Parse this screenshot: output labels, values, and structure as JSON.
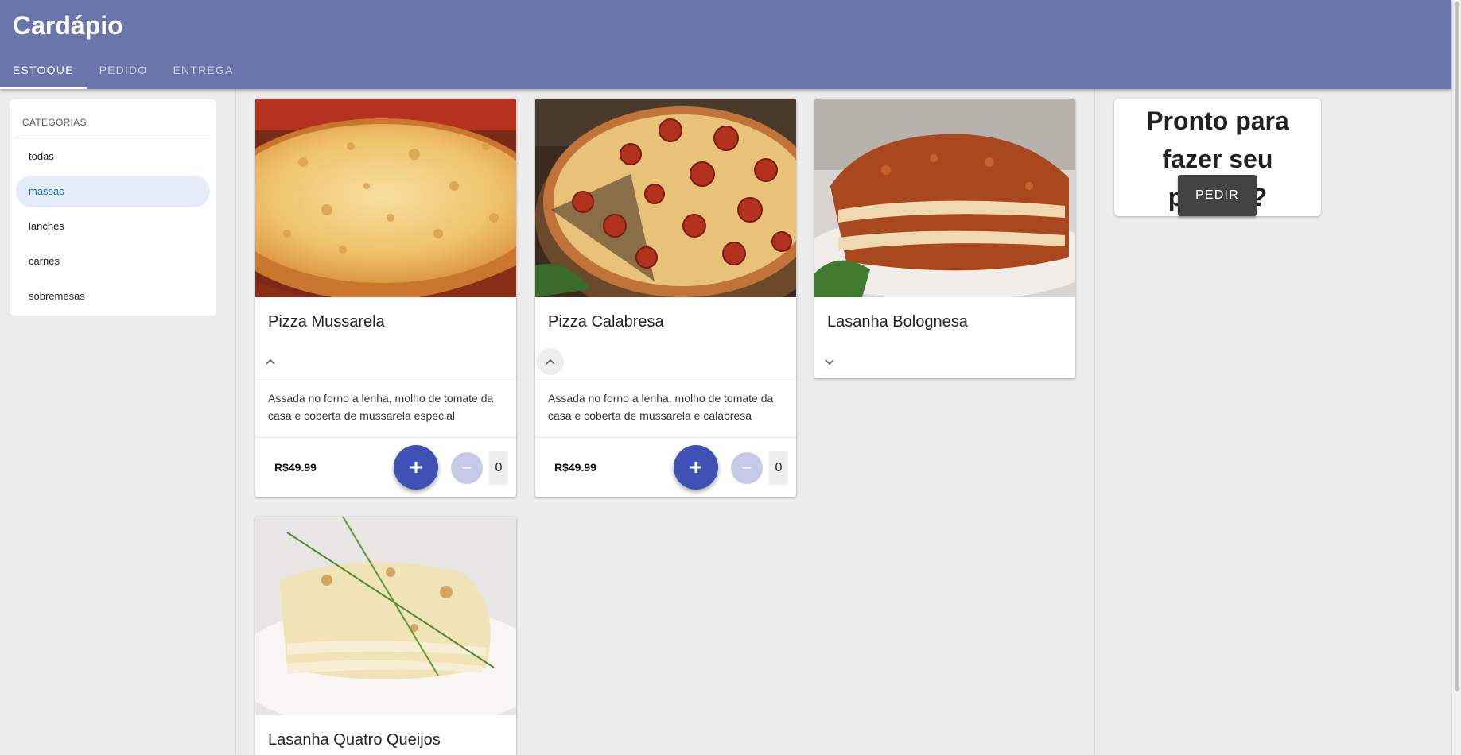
{
  "app": {
    "title": "Cardápio"
  },
  "tabs": [
    {
      "label": "ESTOQUE",
      "active": true
    },
    {
      "label": "PEDIDO",
      "active": false
    },
    {
      "label": "ENTREGA",
      "active": false
    }
  ],
  "sidebar": {
    "header": "CATEGORIAS",
    "items": [
      {
        "label": "todas",
        "selected": false
      },
      {
        "label": "massas",
        "selected": true
      },
      {
        "label": "lanches",
        "selected": false
      },
      {
        "label": "carnes",
        "selected": false
      },
      {
        "label": "sobremesas",
        "selected": false
      }
    ]
  },
  "products": [
    {
      "name": "Pizza Mussarela",
      "description": "Assada no forno a lenha, molho de tomate da casa e coberta de mussarela especial",
      "price": "R$49.99",
      "quantity": "0",
      "add_label": "+",
      "remove_label": "−",
      "expanded": true,
      "expand_icon": "chevron-up-icon"
    },
    {
      "name": "Pizza Calabresa",
      "description": "Assada no forno a lenha, molho de tomate da casa e coberta de mussarela e calabresa",
      "price": "R$49.99",
      "quantity": "0",
      "add_label": "+",
      "remove_label": "−",
      "expanded": true,
      "expand_icon": "chevron-up-icon"
    },
    {
      "name": "Lasanha Bolognesa",
      "expanded": false,
      "expand_icon": "chevron-down-icon"
    },
    {
      "name": "Lasanha Quatro Queijos"
    }
  ],
  "order": {
    "prompt": "Pronto para fazer seu pedido?",
    "button_label": "PEDIR"
  },
  "colors": {
    "appbar": "#6a75ab",
    "primary": "#3f51b5",
    "primary_light": "#c5cae9",
    "selected_bg": "#e3ecf8",
    "selected_text": "#1976d2",
    "dark_button": "#424242"
  }
}
